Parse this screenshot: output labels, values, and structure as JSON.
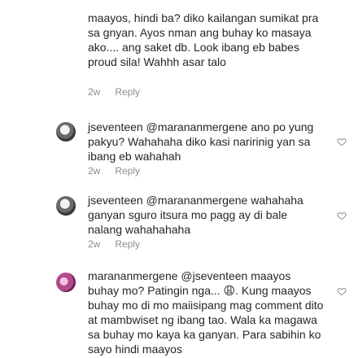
{
  "comments": [
    {
      "username": "",
      "text": "maayos, hindi ba? diko kailangan sumikat pra sa gnyan. Ayos nman ang buhay ko masaya ako.... ang saket db. Look ibang eb babes proud sila! Wahhh asar talo",
      "time": "2w",
      "reply": "Reply"
    },
    {
      "username": "jseventeen",
      "text": "@marananmergene ano po yung pakyu? Wahahaha diko kasi naririnig yan sa ibang eb wahahah",
      "time": "2w",
      "reply": "Reply"
    },
    {
      "username": "jseventeen",
      "text": "@marananmergene wahahaha ganyan sguro itsura mo pagg ay di bale nalang wahahahaha",
      "time": "2w",
      "reply": "Reply"
    },
    {
      "username": "marananmergene",
      "text": "@jseventeen maayos buhay mo? Patingin nga... 😩. Kung maayos buhay mo di mo maiisipang mag comment dito at mambwiset ng ibang tao. Wala ka magawa sa buhay mo kaya ka ganyan. Para sabihin ko sayo hindi maayos"
    }
  ],
  "icons": {
    "heart": "heart-outline-icon"
  }
}
